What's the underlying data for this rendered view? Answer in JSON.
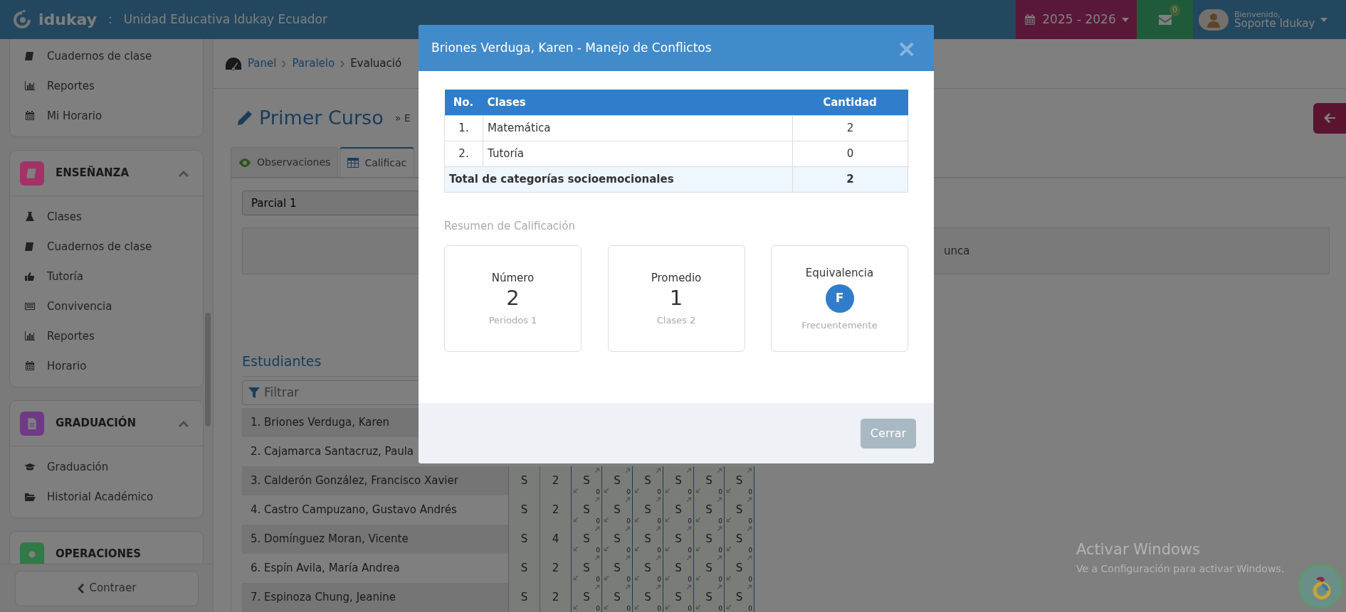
{
  "topbar": {
    "brand": "idukay",
    "separator": ":",
    "school": "Unidad Educativa Idukay Ecuador",
    "year": "2025 - 2026",
    "messages_badge": "0",
    "greeting": "Bienvenido,",
    "user": "Soporte Idukay"
  },
  "sidebar": {
    "sections": [
      {
        "items": [
          "Cuadernos de clase",
          "Reportes",
          "Mi Horario"
        ]
      },
      {
        "title": "ENSEÑANZA",
        "color": "#a33266",
        "expanded": true,
        "items": [
          "Clases",
          "Cuadernos de clase",
          "Tutoría",
          "Convivencia",
          "Reportes",
          "Horario"
        ]
      },
      {
        "title": "GRADUACIÓN",
        "color": "#6e3a86",
        "expanded": true,
        "items": [
          "Graduación",
          "Historial Académico"
        ]
      },
      {
        "title": "OPERACIONES",
        "color": "#2f7a46"
      }
    ],
    "collapse_button": "Contraer"
  },
  "main": {
    "breadcrumb": [
      "Panel",
      "Paralelo",
      "Evaluació"
    ],
    "title": "Primer Curso",
    "subtitle": "» E",
    "tabs": [
      {
        "label": "Observaciones",
        "selected": false
      },
      {
        "label": "Calificac",
        "selected": true
      }
    ],
    "period_select": "Parcial 1",
    "info_text": "unca",
    "students_heading": "Estudiantes",
    "filter_placeholder": "Filtrar",
    "students": [
      {
        "number": "1.",
        "name": "Briones Verduga, Karen"
      },
      {
        "number": "2.",
        "name": "Cajamarca Santacruz, Paula"
      },
      {
        "number": "3.",
        "name": "Calderón González, Francisco Xavier",
        "behavior": "S",
        "count": "2",
        "grades": [
          {
            "value": "S",
            "sub": "0"
          },
          {
            "value": "S",
            "sub": "0"
          },
          {
            "value": "S",
            "sub": "0"
          },
          {
            "value": "S",
            "sub": "0"
          },
          {
            "value": "S",
            "sub": "0"
          },
          {
            "value": "S",
            "sub": "0"
          }
        ]
      },
      {
        "number": "4.",
        "name": "Castro Campuzano, Gustavo Andrés",
        "behavior": "S",
        "count": "2",
        "grades": [
          {
            "value": "S",
            "sub": "0"
          },
          {
            "value": "S",
            "sub": "0"
          },
          {
            "value": "S",
            "sub": "0"
          },
          {
            "value": "S",
            "sub": "0"
          },
          {
            "value": "S",
            "sub": "0"
          },
          {
            "value": "S",
            "sub": "0"
          }
        ]
      },
      {
        "number": "5.",
        "name": "Domínguez Moran, Vicente",
        "behavior": "S",
        "count": "4",
        "grades": [
          {
            "value": "S",
            "sub": "0"
          },
          {
            "value": "S",
            "sub": "0"
          },
          {
            "value": "S",
            "sub": "0"
          },
          {
            "value": "S",
            "sub": "0"
          },
          {
            "value": "S",
            "sub": "0"
          },
          {
            "value": "S",
            "sub": "0"
          }
        ]
      },
      {
        "number": "6.",
        "name": "Espín Avila, María Andrea",
        "behavior": "S",
        "count": "2",
        "grades": [
          {
            "value": "S",
            "sub": "0"
          },
          {
            "value": "S",
            "sub": "0"
          },
          {
            "value": "S",
            "sub": "0"
          },
          {
            "value": "S",
            "sub": "0"
          },
          {
            "value": "S",
            "sub": "0"
          },
          {
            "value": "S",
            "sub": "0"
          }
        ]
      },
      {
        "number": "7.",
        "name": "Espinoza Chung, Jeanine",
        "behavior": "S",
        "count": "2",
        "grades": [
          {
            "value": "S",
            "sub": "0"
          },
          {
            "value": "S",
            "sub": "0"
          },
          {
            "value": "S",
            "sub": "0"
          },
          {
            "value": "S",
            "sub": "0"
          },
          {
            "value": "S",
            "sub": "0"
          },
          {
            "value": "S",
            "sub": "0"
          }
        ]
      }
    ]
  },
  "modal": {
    "title": "Briones Verduga, Karen - Manejo de Conflictos",
    "close": "×",
    "table": {
      "columns": [
        "No.",
        "Clases",
        "Cantidad"
      ],
      "rows": [
        {
          "number": "1.",
          "class": "Matemática",
          "count": "2"
        },
        {
          "number": "2.",
          "class": "Tutoría",
          "count": "0"
        }
      ],
      "total": {
        "label": "Total de categorías socioemocionales",
        "value": "2"
      }
    },
    "summary_title": "Resumen de Calificación",
    "cards": [
      {
        "kind": "number",
        "title": "Número",
        "value": "2",
        "caption": "Periodos 1"
      },
      {
        "kind": "number",
        "title": "Promedio",
        "value": "1",
        "caption": "Clases 2"
      },
      {
        "kind": "badge",
        "title": "Equivalencia",
        "value": "F",
        "caption": "Frecuentemente"
      }
    ],
    "close_button": "Cerrar"
  },
  "os_notice": {
    "title": "Activar Windows",
    "text": "Ve a Configuración para activar Windows."
  }
}
